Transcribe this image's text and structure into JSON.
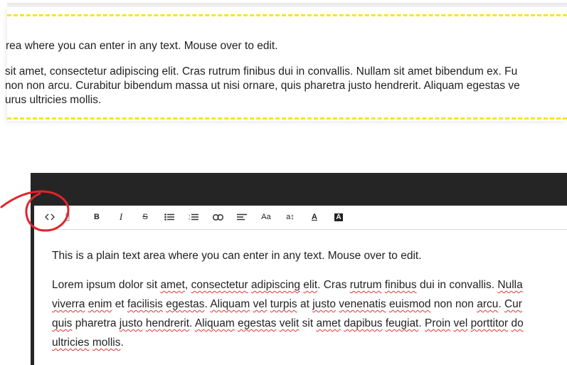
{
  "preview": {
    "line1": "rea where you can enter in any text. Mouse over to edit.",
    "line2": "sit amet, consectetur adipiscing elit. Cras rutrum finibus dui in convallis. Nullam sit amet bibendum ex. Fu",
    "line3": "non non arcu. Curabitur bibendum massa ut nisi ornare, quis pharetra justo hendrerit. Aliquam egestas ve",
    "line4": "urus ultricies mollis."
  },
  "toolbar": {
    "items": [
      {
        "name": "code-view-icon",
        "label": "<>"
      },
      {
        "name": "bold-icon",
        "label": "B"
      },
      {
        "name": "italic-icon",
        "label": "I"
      },
      {
        "name": "strikethrough-icon",
        "label": "S"
      },
      {
        "name": "bullet-list-icon",
        "label": ""
      },
      {
        "name": "numbered-list-icon",
        "label": ""
      },
      {
        "name": "link-icon",
        "label": ""
      },
      {
        "name": "align-left-icon",
        "label": ""
      },
      {
        "name": "font-family-icon",
        "label": "Aa"
      },
      {
        "name": "font-size-icon",
        "label": "a↕"
      },
      {
        "name": "text-color-icon",
        "label": "A"
      },
      {
        "name": "background-color-icon",
        "label": "A"
      }
    ]
  },
  "content": {
    "p1": "This is a plain text area where you can enter in any text. Mouse over to edit.",
    "p2_lines": [
      [
        "Lorem ipsum dolor sit ",
        {
          "w": "amet"
        },
        ", ",
        {
          "w": "consectetur"
        },
        " ",
        {
          "w": "adipiscing"
        },
        " ",
        {
          "w": "elit"
        },
        ". Cras ",
        {
          "w": "rutrum"
        },
        " ",
        {
          "w": "finibus"
        },
        " dui in convallis. ",
        {
          "w": "Nulla"
        }
      ],
      [
        {
          "w": "viverra"
        },
        " ",
        {
          "w": "enim"
        },
        " et ",
        {
          "w": "facilisis"
        },
        " ",
        {
          "w": "egestas"
        },
        ". ",
        {
          "w": "Aliquam"
        },
        " ",
        {
          "w": "vel"
        },
        " ",
        {
          "w": "turpis"
        },
        " at ",
        {
          "w": "justo"
        },
        " ",
        {
          "w": "venenatis"
        },
        " ",
        {
          "w": "euismod"
        },
        " non non ",
        {
          "w": "arcu"
        },
        ". ",
        {
          "w": "Cur"
        }
      ],
      [
        {
          "w": "quis"
        },
        " pharetra ",
        {
          "w": "justo"
        },
        " ",
        {
          "w": "hendrerit"
        },
        ". ",
        {
          "w": "Aliquam"
        },
        " ",
        {
          "w": "egestas"
        },
        " ",
        {
          "w": "velit"
        },
        " sit ",
        {
          "w": "amet"
        },
        " ",
        {
          "w": "dapibus"
        },
        " ",
        {
          "w": "feugiat"
        },
        ". ",
        {
          "w": "Proin"
        },
        " ",
        {
          "w": "vel"
        },
        " ",
        {
          "w": "porttitor"
        },
        " ",
        {
          "w": "do"
        }
      ],
      [
        {
          "w": "ultricies"
        },
        " ",
        {
          "w": "mollis"
        },
        "."
      ]
    ]
  },
  "colors": {
    "header": "#252525",
    "dash": "#f6e52b",
    "annotation": "#e0252b"
  }
}
